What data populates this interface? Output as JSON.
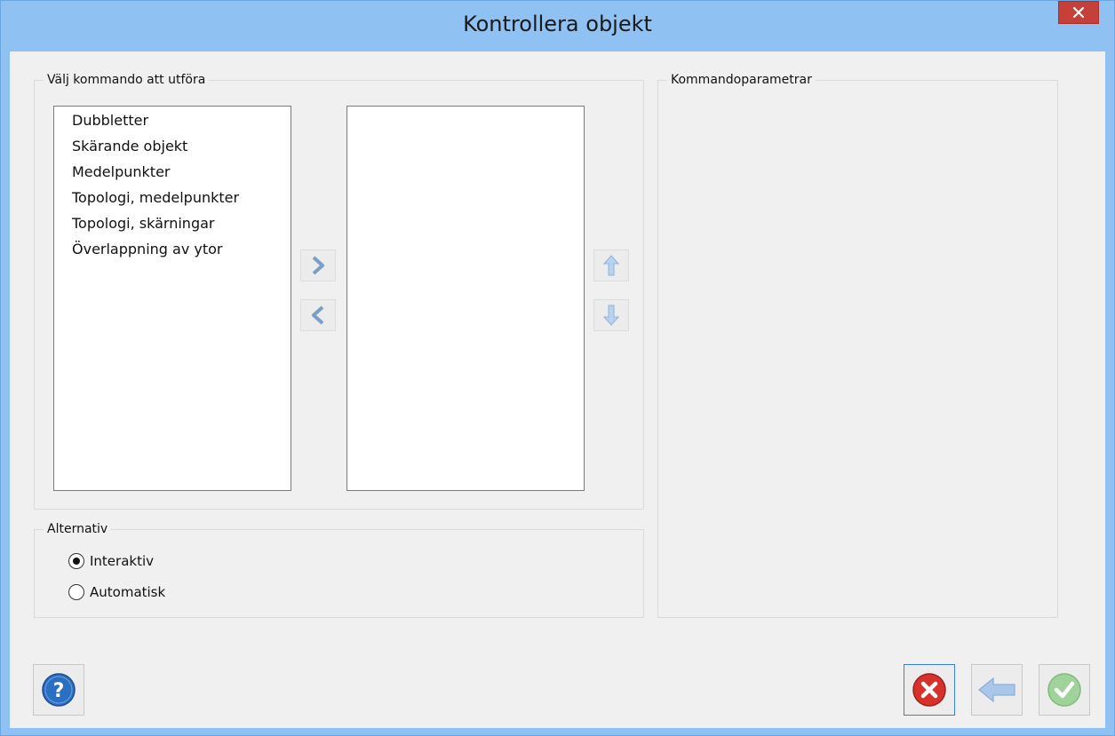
{
  "window": {
    "title": "Kontrollera objekt"
  },
  "commands_group": {
    "label": "Välj kommando att utföra"
  },
  "available_commands": [
    {
      "label": "Dubbletter"
    },
    {
      "label": "Skärande objekt"
    },
    {
      "label": "Medelpunkter"
    },
    {
      "label": "Topologi, medelpunkter"
    },
    {
      "label": "Topologi, skärningar"
    },
    {
      "label": "Överlappning av ytor"
    }
  ],
  "selected_commands": [],
  "parameters_group": {
    "label": "Kommandoparametrar"
  },
  "options_group": {
    "label": "Alternativ",
    "radios": [
      {
        "label": "Interaktiv",
        "checked": true
      },
      {
        "label": "Automatisk",
        "checked": false
      }
    ]
  },
  "icons": {
    "close": "close-icon",
    "add": "chevron-right-icon",
    "remove": "chevron-left-icon",
    "up": "arrow-up-icon",
    "down": "arrow-down-icon",
    "help": "help-icon",
    "cancel": "cancel-icon",
    "back": "back-arrow-icon",
    "ok": "ok-check-icon"
  },
  "colors": {
    "titlebar": "#8fc1f2",
    "close_button": "#c6403a",
    "cancel_icon": "#d7312c",
    "help_icon": "#2a6fc2",
    "disabled_blue": "#a9c7ea",
    "disabled_green": "#9fd39a"
  }
}
